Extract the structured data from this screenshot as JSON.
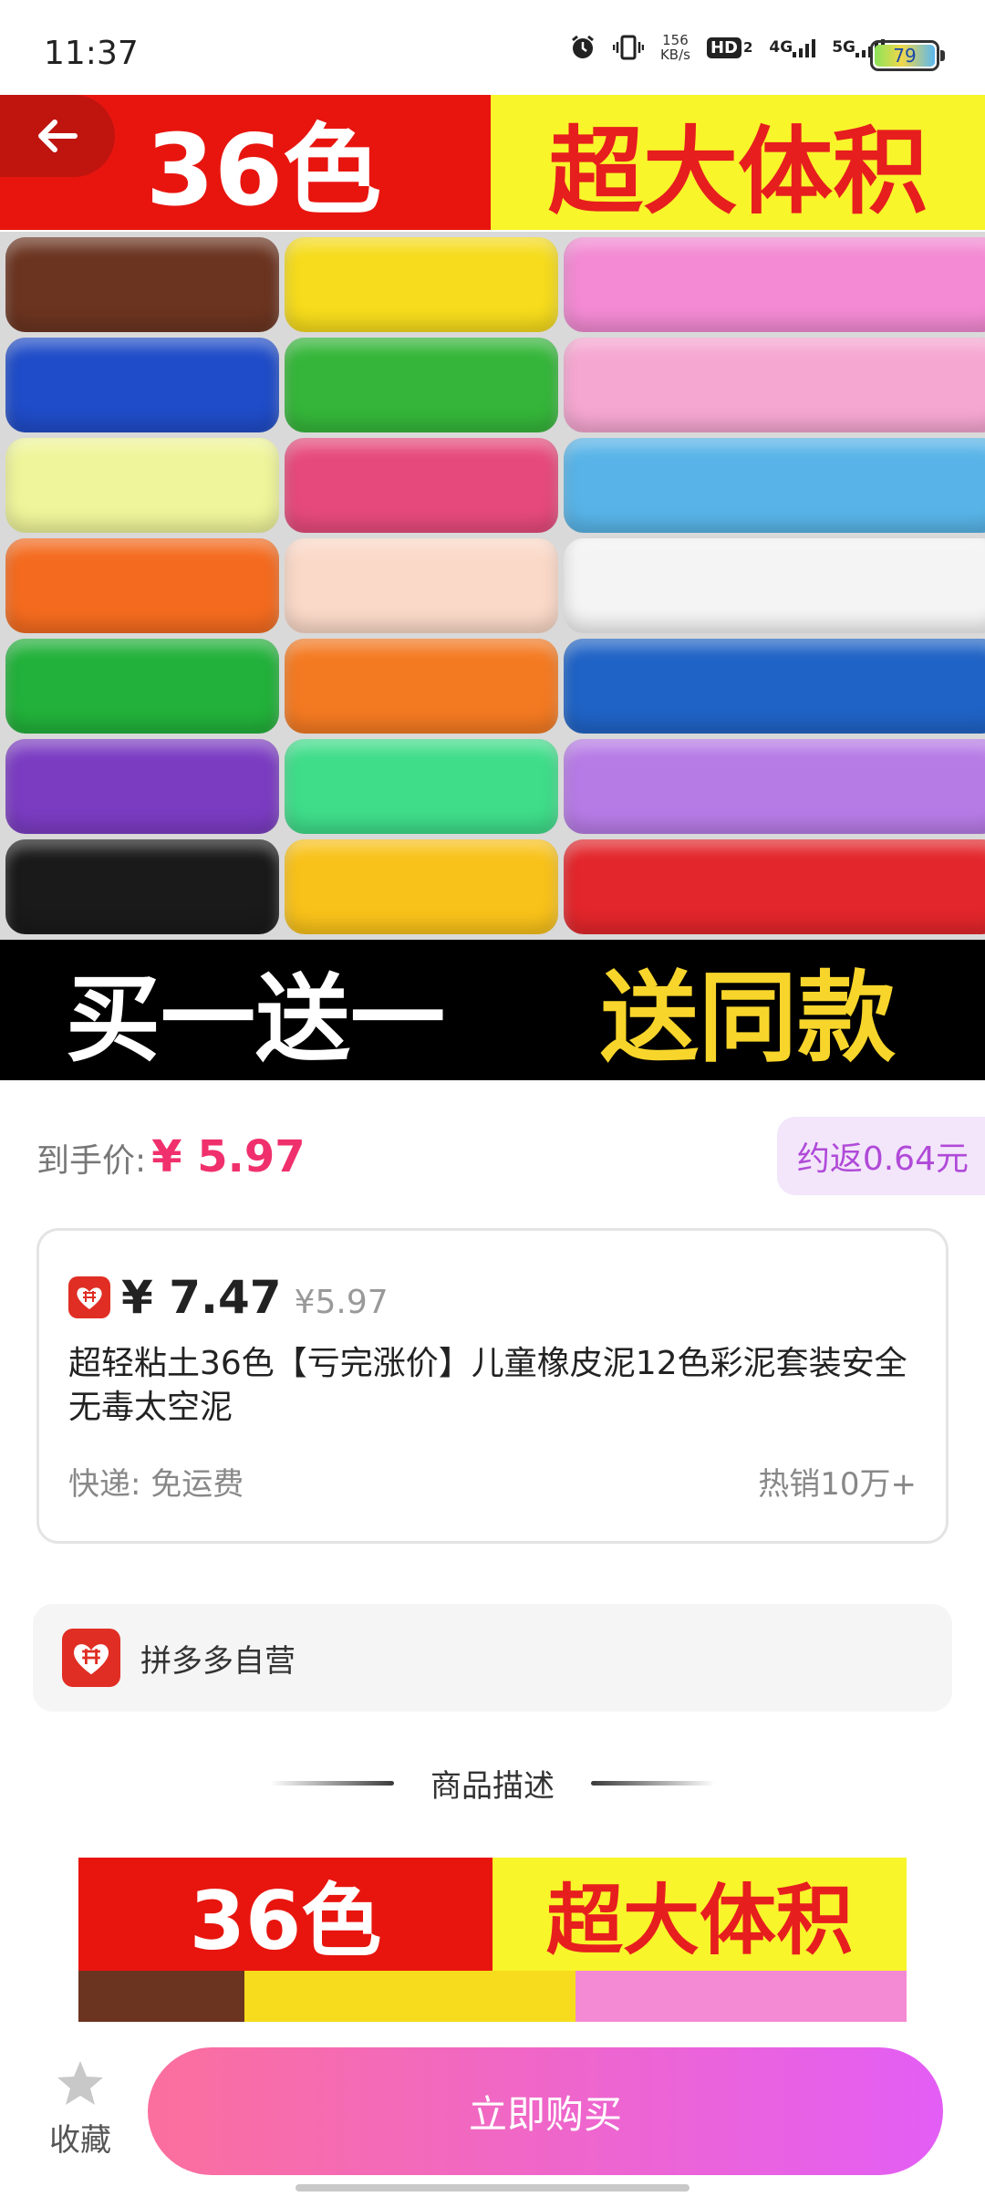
{
  "status_bar": {
    "time": "11:37",
    "net_speed_value": "156",
    "net_speed_unit": "KB/s",
    "hd_label": "HD",
    "hd_sub": "2",
    "net_4g": "4G",
    "net_5g": "5G",
    "battery": "79"
  },
  "hero": {
    "top_left_text": "36色",
    "top_right_text": "超大体积",
    "bottom_left_text": "买一送一",
    "bottom_right_text": "送同款",
    "pack_colors": [
      "#6b3420",
      "#f6dc1c",
      "#f38ad3",
      "#1f4cc8",
      "#35b63a",
      "#f6a7d1",
      "#eff59a",
      "#e64a7c",
      "#58b4e8",
      "#f46b1f",
      "#fbd9c8",
      "#f4f4f4",
      "#22b13a",
      "#f47a22",
      "#1f63c6",
      "#7b3cc2",
      "#3fdd8a",
      "#b77be6",
      "#1a1a1a",
      "#f9c21a",
      "#e3262b"
    ]
  },
  "price": {
    "label": "到手价:",
    "value": "¥ 5.97",
    "rebate": "约返0.64元"
  },
  "product": {
    "price": "¥ 7.47",
    "old_price": "¥5.97",
    "title": "超轻粘土36色【亏完涨价】儿童橡皮泥12色彩泥套装安全无毒太空泥",
    "shipping": "快递: 免运费",
    "sales": "热销10万+"
  },
  "store": {
    "name": "拼多多自营"
  },
  "section": {
    "title": "商品描述"
  },
  "description_image": {
    "top_left_text": "36色",
    "top_right_text": "超大体积",
    "strip_colors": [
      "#6b3420",
      "#f6dc1c",
      "#f6dc1c",
      "#f38ad3",
      "#f38ad3"
    ]
  },
  "bottom_bar": {
    "favorite_label": "收藏",
    "buy_label": "立即购买"
  },
  "colors": {
    "accent_pink": "#f0306c",
    "rebate_purple": "#b04ad8",
    "pdd_red": "#e02e24"
  }
}
